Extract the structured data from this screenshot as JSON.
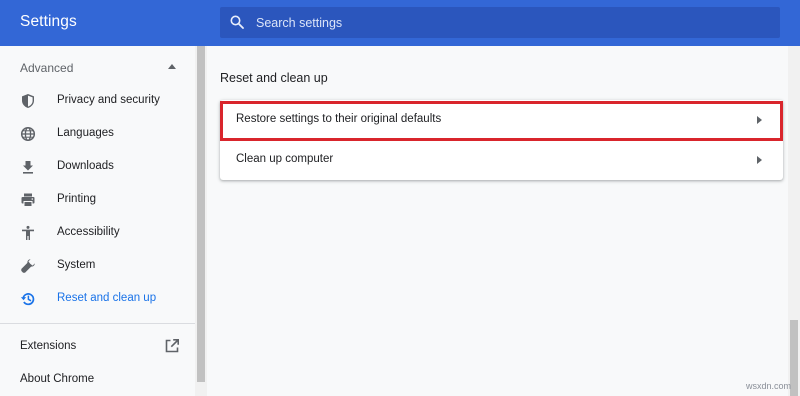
{
  "header": {
    "title": "Settings",
    "search_placeholder": "Search settings"
  },
  "sidebar": {
    "advanced_label": "Advanced",
    "items": [
      {
        "label": "Privacy and security",
        "icon": "shield-icon"
      },
      {
        "label": "Languages",
        "icon": "globe-icon"
      },
      {
        "label": "Downloads",
        "icon": "download-icon"
      },
      {
        "label": "Printing",
        "icon": "printer-icon"
      },
      {
        "label": "Accessibility",
        "icon": "accessibility-icon"
      },
      {
        "label": "System",
        "icon": "wrench-icon"
      },
      {
        "label": "Reset and clean up",
        "icon": "restore-icon",
        "active": true
      }
    ],
    "extensions_label": "Extensions",
    "about_label": "About Chrome"
  },
  "main": {
    "section_title": "Reset and clean up",
    "rows": [
      {
        "label": "Restore settings to their original defaults",
        "highlighted": true
      },
      {
        "label": "Clean up computer"
      }
    ]
  },
  "watermark": "wsxdn.com",
  "colors": {
    "header_bg": "#3367d6",
    "search_bg": "#2b56bd",
    "active_text": "#1a73e8",
    "highlight_border": "#d9252c"
  }
}
